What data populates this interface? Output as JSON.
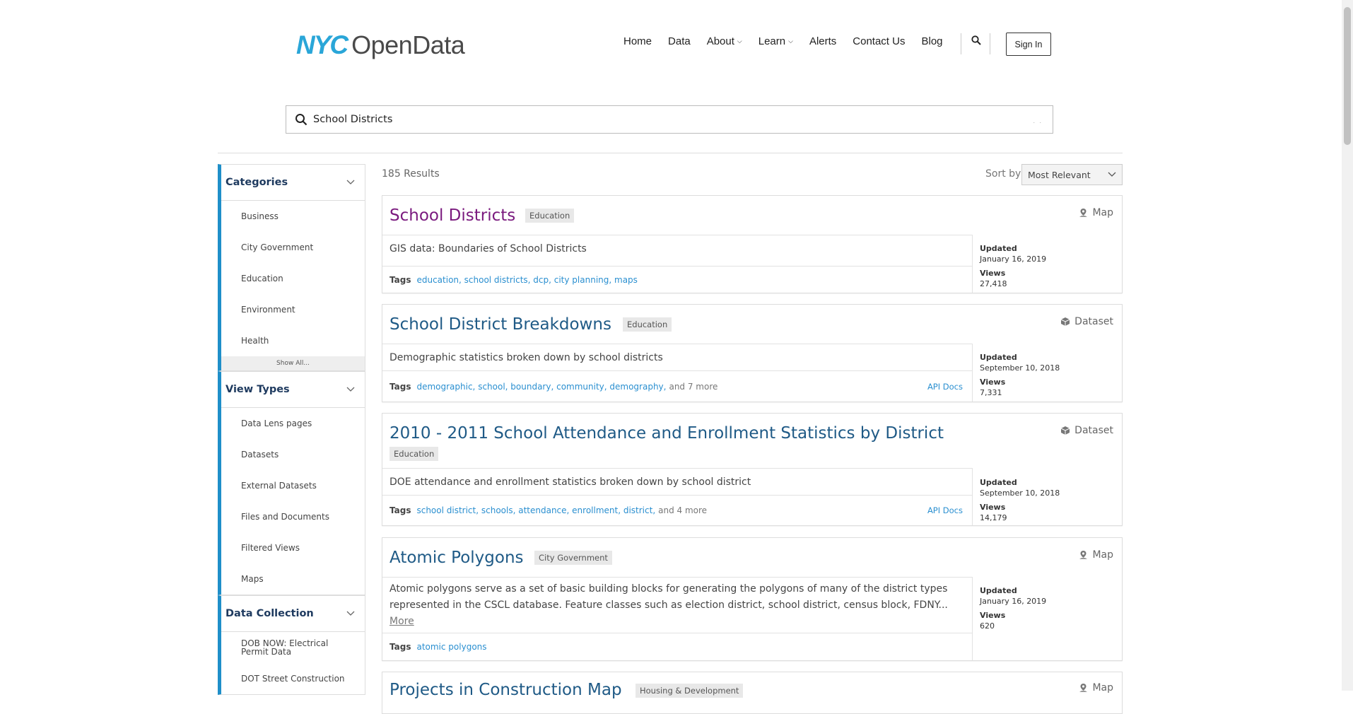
{
  "header": {
    "logo_nyc": "NYC",
    "logo_opendata": "OpenData",
    "nav": [
      "Home",
      "Data",
      "About",
      "Learn",
      "Alerts",
      "Contact Us",
      "Blog"
    ],
    "signin": "Sign In"
  },
  "search": {
    "value": "School Districts",
    "clear": ". ."
  },
  "sidebar": {
    "categories": {
      "title": "Categories",
      "items": [
        "Business",
        "City Government",
        "Education",
        "Environment",
        "Health"
      ],
      "show_all": "Show All..."
    },
    "view_types": {
      "title": "View Types",
      "items": [
        "Data Lens pages",
        "Datasets",
        "External Datasets",
        "Files and Documents",
        "Filtered Views",
        "Maps"
      ]
    },
    "data_collection": {
      "title": "Data Collection",
      "items": [
        "DOB NOW: Electrical Permit Data",
        "DOT Street Construction"
      ]
    }
  },
  "results": {
    "count": "185 Results",
    "sort_label": "Sort by",
    "sort_value": "Most Relevant",
    "tags_label": "Tags",
    "updated_label": "Updated",
    "views_label": "Views",
    "api_docs": "API Docs",
    "more_label": "More",
    "items": [
      {
        "title": "School Districts",
        "category": "Education",
        "type": "Map",
        "description": "GIS data: Boundaries of School Districts",
        "tags": "education, school districts, dcp, city planning, maps",
        "tags_more": "",
        "updated": "January 16, 2019",
        "views": "27,418"
      },
      {
        "title": "School District Breakdowns",
        "category": "Education",
        "type": "Dataset",
        "description": "Demographic statistics broken down by school districts",
        "tags": "demographic, school, boundary, community, demography,",
        "tags_more": "and 7 more",
        "updated": "September 10, 2018",
        "views": "7,331"
      },
      {
        "title": "2010 - 2011 School Attendance and Enrollment Statistics by District",
        "category": "Education",
        "type": "Dataset",
        "description": "DOE attendance and enrollment statistics broken down by school district",
        "tags": "school district, schools, attendance, enrollment, district,",
        "tags_more": "and 4 more",
        "updated": "September 10, 2018",
        "views": "14,179"
      },
      {
        "title": "Atomic Polygons",
        "category": "City Government",
        "type": "Map",
        "description": "Atomic polygons serve as a set of basic building blocks for generating the polygons of many of the district types represented in the CSCL database. Feature classes such as election district, school district, census block, FDNY...",
        "tags": "atomic polygons",
        "tags_more": "",
        "updated": "January 16, 2019",
        "views": "620"
      },
      {
        "title": "Projects in Construction Map",
        "category": "Housing & Development",
        "type": "Map"
      }
    ]
  }
}
